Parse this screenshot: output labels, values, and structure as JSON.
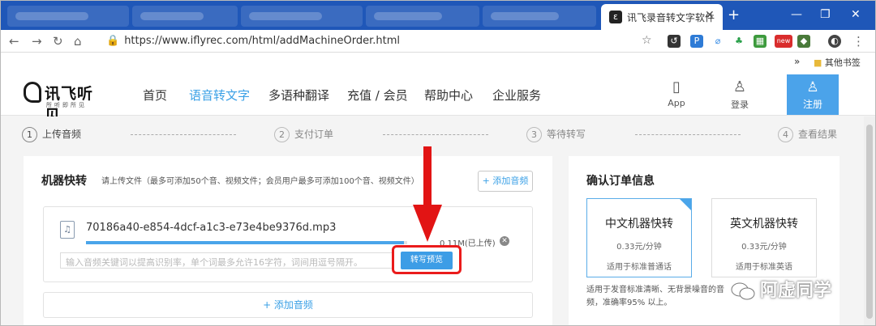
{
  "browser": {
    "active_tab_title": "讯飞录音转文字软件",
    "url": "https://www.iflyrec.com/html/addMachineOrder.html",
    "bookmarks_overflow": "»",
    "other_bookmarks": "其他书签",
    "new_badge": "new"
  },
  "site": {
    "logo_name": "讯飞听见",
    "logo_tagline": "所听即所见",
    "nav": [
      "首页",
      "语音转文字",
      "多语种翻译",
      "充值 / 会员",
      "帮助中心",
      "企业服务"
    ],
    "active_nav": "语音转文字",
    "app_label": "App",
    "login_label": "登录",
    "register_label": "注册"
  },
  "steps": [
    {
      "num": "1",
      "label": "上传音频"
    },
    {
      "num": "2",
      "label": "支付订单"
    },
    {
      "num": "3",
      "label": "等待转写"
    },
    {
      "num": "4",
      "label": "查看结果"
    }
  ],
  "upload": {
    "title": "机器快转",
    "hint": "请上传文件（最多可添加50个音、视频文件；会员用户最多可添加100个音、视频文件）",
    "add_button_top": "+ 添加音频",
    "file_name": "70186a40-e854-4dcf-a1c3-e73e4be9376d.mp3",
    "file_size": "0.11M(已上传)",
    "progress": 0.99,
    "keyword_placeholder": "输入音频关键词以提高识别率，单个词最多允许16字符，词间用逗号隔开。",
    "preview_button": "转写预览",
    "add_button_bottom": "+ 添加音频"
  },
  "order": {
    "title": "确认订单信息",
    "options": [
      {
        "name": "中文机器快转",
        "price": "0.33元/分钟",
        "desc": "适用于标准普通话",
        "selected": true
      },
      {
        "name": "英文机器快转",
        "price": "0.33元/分钟",
        "desc": "适用于标准英语",
        "selected": false
      }
    ],
    "note": "适用于发音标准清晰、无背景噪音的音频，准确率95% 以上。"
  },
  "watermark": "阿虚同学",
  "colors": {
    "tab_bar": "#1f57b8",
    "accent": "#3aa0e6",
    "register_bg": "#4ba3ea",
    "highlight": "#ea1b1b"
  }
}
